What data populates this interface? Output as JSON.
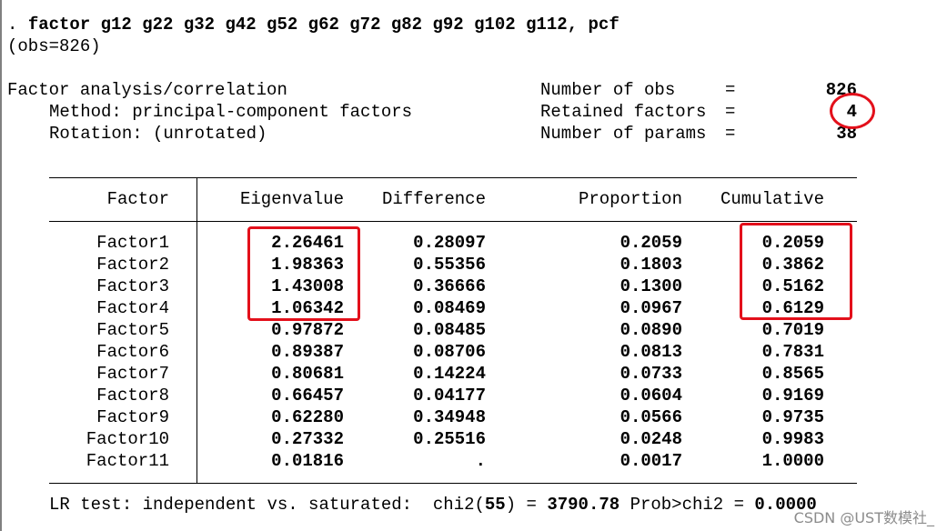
{
  "command": {
    "prompt": ". ",
    "text": "factor g12 g22 g32 g42 g52 g62 g72 g82 g92 g102 g112, pcf",
    "obs": "(obs=826)"
  },
  "header": {
    "title": "Factor analysis/correlation",
    "method": "Method: principal-component factors",
    "rotation": "Rotation: (unrotated)",
    "stats": [
      {
        "label": "Number of obs",
        "eq": "=",
        "value": "826"
      },
      {
        "label": "Retained factors",
        "eq": "=",
        "value": "4"
      },
      {
        "label": "Number of params",
        "eq": "=",
        "value": "38"
      }
    ]
  },
  "table": {
    "columns": [
      "Factor",
      "Eigenvalue",
      "Difference",
      "Proportion",
      "Cumulative"
    ],
    "rows": [
      {
        "factor": "Factor1",
        "eigen": "2.26461",
        "diff": "0.28097",
        "prop": "0.2059",
        "cum": "0.2059"
      },
      {
        "factor": "Factor2",
        "eigen": "1.98363",
        "diff": "0.55356",
        "prop": "0.1803",
        "cum": "0.3862"
      },
      {
        "factor": "Factor3",
        "eigen": "1.43008",
        "diff": "0.36666",
        "prop": "0.1300",
        "cum": "0.5162"
      },
      {
        "factor": "Factor4",
        "eigen": "1.06342",
        "diff": "0.08469",
        "prop": "0.0967",
        "cum": "0.6129"
      },
      {
        "factor": "Factor5",
        "eigen": "0.97872",
        "diff": "0.08485",
        "prop": "0.0890",
        "cum": "0.7019"
      },
      {
        "factor": "Factor6",
        "eigen": "0.89387",
        "diff": "0.08706",
        "prop": "0.0813",
        "cum": "0.7831"
      },
      {
        "factor": "Factor7",
        "eigen": "0.80681",
        "diff": "0.14224",
        "prop": "0.0733",
        "cum": "0.8565"
      },
      {
        "factor": "Factor8",
        "eigen": "0.66457",
        "diff": "0.04177",
        "prop": "0.0604",
        "cum": "0.9169"
      },
      {
        "factor": "Factor9",
        "eigen": "0.62280",
        "diff": "0.34948",
        "prop": "0.0566",
        "cum": "0.9735"
      },
      {
        "factor": "Factor10",
        "eigen": "0.27332",
        "diff": "0.25516",
        "prop": "0.0248",
        "cum": "0.9983"
      },
      {
        "factor": "Factor11",
        "eigen": "0.01816",
        "diff": ".",
        "prop": "0.0017",
        "cum": "1.0000"
      }
    ]
  },
  "lrtest": {
    "label": "LR test: independent vs. saturated:",
    "chi_pre": "chi2(",
    "df": "55",
    "chi_post": ") =",
    "chi_value": "3790.78",
    "prob_label": "Prob>chi2 =",
    "prob_value": "0.0000"
  },
  "watermark": "CSDN @UST数模社_",
  "colors": {
    "highlight": "#e3101b",
    "text": "#000000",
    "watermark": "#8c8c8c"
  }
}
